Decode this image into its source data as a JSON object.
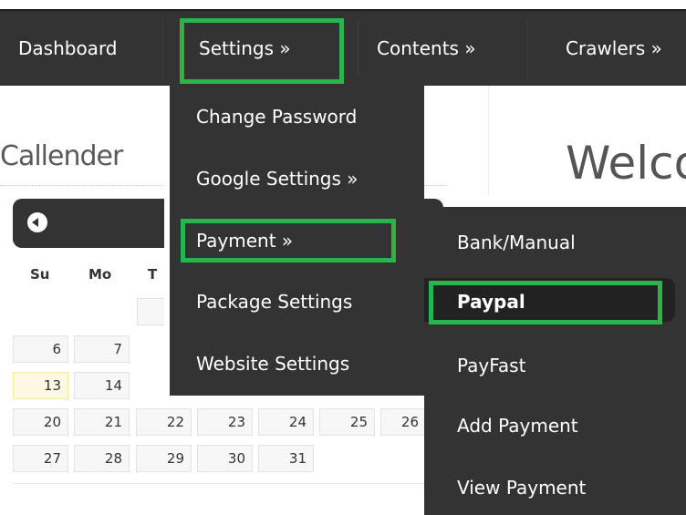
{
  "nav": {
    "dashboard": "Dashboard",
    "settings": "Settings »",
    "contents": "Contents »",
    "crawlers": "Crawlers »"
  },
  "settings_menu": {
    "items": [
      "Change Password",
      "Google Settings »",
      "Payment »",
      "Package Settings",
      "Website Settings"
    ]
  },
  "payment_menu": {
    "items": [
      "Bank/Manual",
      "Paypal",
      "PayFast",
      "Add Payment",
      "View Payment"
    ]
  },
  "calendar": {
    "title": "Callender",
    "days": [
      "Su",
      "Mo",
      "T"
    ],
    "row1": [
      "6",
      "7"
    ],
    "row2": [
      "13",
      "14"
    ],
    "row3": [
      "20",
      "21",
      "22",
      "23",
      "24",
      "25",
      "26"
    ],
    "row4": [
      "27",
      "28",
      "29",
      "30",
      "31"
    ]
  },
  "main": {
    "welcome": "Welco"
  },
  "colors": {
    "nav_bg": "#333333",
    "highlight": "#2ab54a",
    "today_bg": "#fcf8e3"
  }
}
